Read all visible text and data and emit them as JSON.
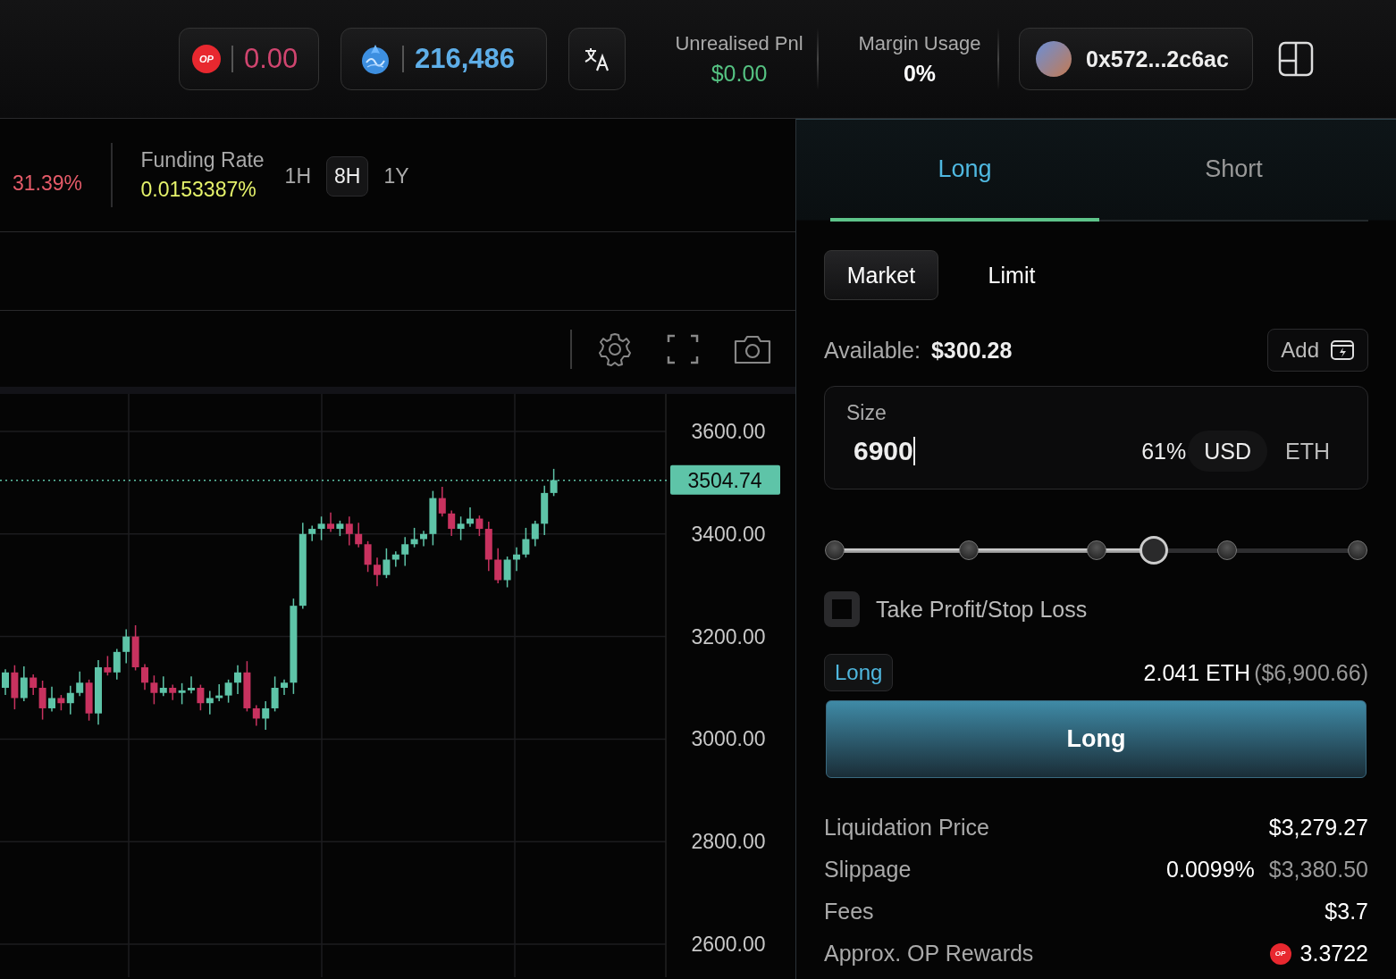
{
  "header": {
    "op_balance": {
      "logo_text": "OP",
      "value": "0.00"
    },
    "points_balance": {
      "value": "216,486"
    },
    "stats": [
      {
        "label": "Unrealised Pnl",
        "value": "$0.00",
        "color": "#55c282"
      },
      {
        "label": "Margin Usage",
        "value": "0%",
        "color": "#ffffff"
      }
    ],
    "wallet": {
      "address": "0x572...2c6ac"
    }
  },
  "market_stats": {
    "change": "31.39%",
    "funding": {
      "label": "Funding Rate",
      "value": "0.0153387%"
    },
    "intervals": [
      {
        "label": "1H",
        "selected": false
      },
      {
        "label": "8H",
        "selected": true
      },
      {
        "label": "1Y",
        "selected": false
      }
    ]
  },
  "chart": {
    "y_axis": [
      "3600.00",
      "3400.00",
      "3200.00",
      "3000.00",
      "2800.00",
      "2600.00"
    ],
    "last_price": "3504.74"
  },
  "order_panel": {
    "sides": [
      {
        "label": "Long",
        "selected": true
      },
      {
        "label": "Short",
        "selected": false
      }
    ],
    "order_types": [
      {
        "label": "Market",
        "selected": true
      },
      {
        "label": "Limit",
        "selected": false
      }
    ],
    "available": {
      "label": "Available:",
      "value": "$300.28"
    },
    "add_button": "Add",
    "size": {
      "label": "Size",
      "value": "6900",
      "percent": "61%",
      "units": [
        {
          "label": "USD",
          "selected": true
        },
        {
          "label": "ETH",
          "selected": false
        }
      ]
    },
    "leverage_slider": {
      "level": 0.61
    },
    "tpsl": {
      "label": "Take Profit/Stop Loss",
      "checked": false
    },
    "summary": {
      "side_tag": "Long",
      "amount": "2.041 ETH",
      "amount_usd": "($6,900.66)"
    },
    "submit_button": "Long",
    "details": [
      {
        "label": "Liquidation Price",
        "value": "$3,279.27"
      },
      {
        "label": "Slippage",
        "value": "0.0099%",
        "secondary": "$3,380.50"
      },
      {
        "label": "Fees",
        "value": "$3.7"
      },
      {
        "label": "Approx. OP Rewards",
        "value": "3.3722",
        "logo_text": "OP"
      }
    ]
  }
}
